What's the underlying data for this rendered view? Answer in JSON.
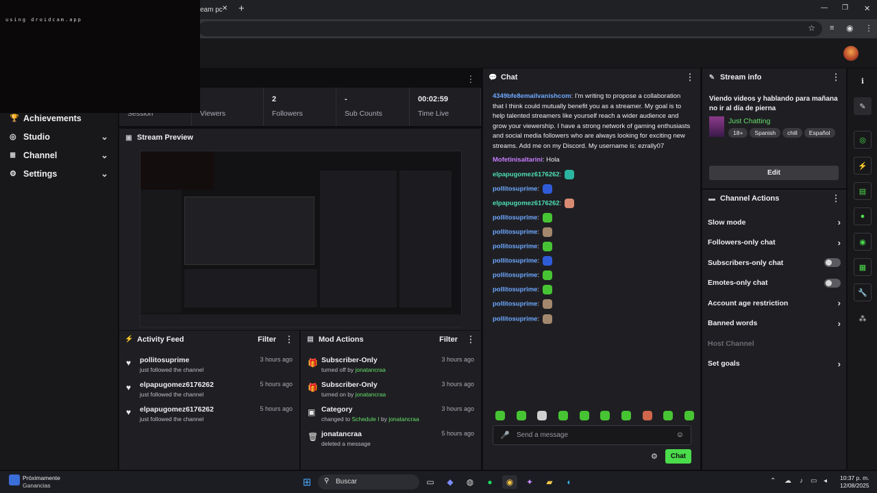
{
  "browser": {
    "tab_title": "eam pc",
    "close": "✕",
    "new_tab": "+",
    "min": "—",
    "restore": "❐",
    "close_win": "✕"
  },
  "camera_overlay": {
    "text": "using droidcam.app"
  },
  "stats": [
    {
      "value": "",
      "label": "Session"
    },
    {
      "value": "",
      "label": "Viewers"
    },
    {
      "value": "2",
      "label": "Followers"
    },
    {
      "value": "-",
      "label": "Sub Counts"
    },
    {
      "value": "00:02:59",
      "label": "Time Live"
    }
  ],
  "sidebar": {
    "items": [
      {
        "label": "Achievements",
        "icon": "trophy-icon",
        "chev": false
      },
      {
        "label": "Studio",
        "icon": "studio-icon",
        "chev": true
      },
      {
        "label": "Channel",
        "icon": "channel-icon",
        "chev": true
      },
      {
        "label": "Settings",
        "icon": "gear-icon",
        "chev": true
      }
    ]
  },
  "stream_preview": {
    "title": "Stream Preview"
  },
  "activity": {
    "title": "Activity Feed",
    "filter": "Filter",
    "items": [
      {
        "user": "pollitosuprime",
        "sub": "just followed the channel",
        "time": "3 hours ago"
      },
      {
        "user": "elpapugomez6176262",
        "sub": "just followed the channel",
        "time": "5 hours ago"
      },
      {
        "user": "elpapugomez6176262",
        "sub": "just followed the channel",
        "time": "5 hours ago"
      }
    ]
  },
  "mod": {
    "title": "Mod Actions",
    "filter": "Filter",
    "items": [
      {
        "title": "Subscriber-Only",
        "pre": "turned off by ",
        "hl": "jonatancraa",
        "mid": "",
        "hl2": "",
        "time": "3 hours ago",
        "icon": "gift-icon"
      },
      {
        "title": "Subscriber-Only",
        "pre": "turned on by ",
        "hl": "jonatancraa",
        "mid": "",
        "hl2": "",
        "time": "3 hours ago",
        "icon": "gift-icon"
      },
      {
        "title": "Category",
        "pre": "changed to ",
        "hl": "Schedule I",
        "mid": " by ",
        "hl2": "jonatancraa",
        "time": "3 hours ago",
        "icon": "category-icon"
      },
      {
        "title": "jonatancraa",
        "pre": "deleted a message",
        "hl": "",
        "mid": "",
        "hl2": "",
        "time": "5 hours ago",
        "icon": "trash-icon"
      }
    ]
  },
  "chat": {
    "title": "Chat",
    "placeholder": "Send a message",
    "send": "Chat",
    "first": {
      "user": "4349bfe8emailvanishcom",
      "text": ": I'm writing to propose a collaboration that I think could mutually benefit you as a streamer. My goal is to help talented streamers like yourself reach a wider audience and grow your viewership. I have a strong network of gaming enthusiasts and social media followers who are always looking for exciting new streams. Add me on my Discord. My username is: ezrally07"
    },
    "second": {
      "user": "Mofetinisaltarini",
      "text": ": Hola"
    },
    "messages": [
      {
        "user": "elpapugomez6176262",
        "color": "u-green",
        "emote": "#2bb5a0"
      },
      {
        "user": "pollitosuprime",
        "color": "u-blue",
        "emote": "#2f5bd8"
      },
      {
        "user": "elpapugomez6176262",
        "color": "u-green",
        "emote": "#d98a72"
      },
      {
        "user": "pollitosuprime",
        "color": "u-blue",
        "emote": "#47c433"
      },
      {
        "user": "pollitosuprime",
        "color": "u-blue",
        "emote": "#a3886d"
      },
      {
        "user": "pollitosuprime",
        "color": "u-blue",
        "emote": "#47c433"
      },
      {
        "user": "pollitosuprime",
        "color": "u-blue",
        "emote": "#2f5bd8"
      },
      {
        "user": "pollitosuprime",
        "color": "u-blue",
        "emote": "#47c433"
      },
      {
        "user": "pollitosuprime",
        "color": "u-blue",
        "emote": "#47c433"
      },
      {
        "user": "pollitosuprime",
        "color": "u-blue",
        "emote": "#a3886d"
      },
      {
        "user": "pollitosuprime",
        "color": "u-blue",
        "emote": "#a3886d"
      }
    ],
    "emote_bar": [
      "#47c433",
      "#47c433",
      "#cfcfcf",
      "#47c433",
      "#47c433",
      "#47c433",
      "#47c433",
      "#d0664c",
      "#47c433",
      "#47c433"
    ]
  },
  "stream_info": {
    "title": "Stream info",
    "stream_title": "Viendo videos y hablando para mañana no ir al día de pierna",
    "category": "Just Chatting",
    "tags": [
      "18+",
      "Spanish",
      "chill",
      "Español"
    ],
    "edit": "Edit"
  },
  "channel_actions": {
    "title": "Channel Actions",
    "items": [
      {
        "label": "Slow mode",
        "kind": "chev"
      },
      {
        "label": "Followers-only chat",
        "kind": "chev"
      },
      {
        "label": "Subscribers-only chat",
        "kind": "toggle"
      },
      {
        "label": "Emotes-only chat",
        "kind": "toggle"
      },
      {
        "label": "Account age restriction",
        "kind": "chev"
      },
      {
        "label": "Banned words",
        "kind": "chev"
      },
      {
        "label": "Host Channel",
        "kind": "disabled"
      },
      {
        "label": "Set goals",
        "kind": "chev"
      }
    ]
  },
  "taskbar": {
    "weather": "Próximamente",
    "weather_sub": "Ganancias",
    "search": "Buscar",
    "time": "10:37 p. m.",
    "date": "12/08/2025"
  },
  "colors": {
    "accent": "#4bdc4b",
    "panel": "#1f1f23",
    "bg": "#0e0e10"
  }
}
